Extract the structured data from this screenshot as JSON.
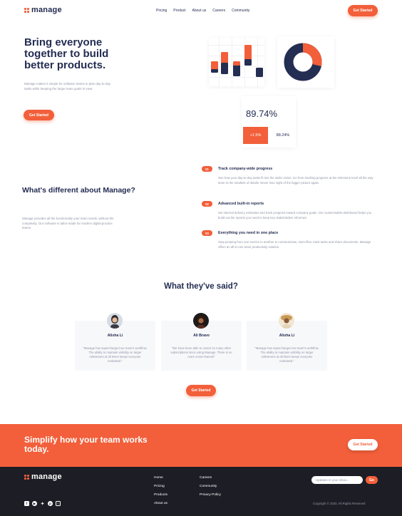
{
  "brand": {
    "name": "manage",
    "accent": "#f25f3a",
    "dark": "#242d52",
    "footer_bg": "#1d1e25"
  },
  "nav": {
    "items": [
      "Pricing",
      "Product",
      "About us",
      "Careers",
      "Community"
    ],
    "cta": "Get Started"
  },
  "hero": {
    "title": "Bring everyone together to build better products.",
    "description": "Manage makes it simple for software teams to plan day-to-day tasks while keeping the larger team goals in view.",
    "cta": "Get Started"
  },
  "illustration": {
    "stat_main": "89.74%",
    "stat_change": "+1.5%",
    "stat_secondary": "88.24%"
  },
  "features": {
    "title": "What's different about Manage?",
    "description": "Manage provides all the functionality your team needs, without the complexity. Our software is tailor-made for modern digital product teams.",
    "items": [
      {
        "num": "01",
        "title": "Track company-wide progress",
        "desc": "See how your day-to-day tasks fit into the wider vision. Go from tracking progress at the milestone level all the way done to the smallest of details. Never lose sight of the bigger picture again."
      },
      {
        "num": "02",
        "title": "Advanced built-in reports",
        "desc": "Set internal delivery estimates and track progress toward company goals. Our customisable dashboard helps you build out the reports you need to keep key stakeholders informed."
      },
      {
        "num": "03",
        "title": "Everything you need in one place",
        "desc": "Stop jumping from one service to another to communicate, store files, track tasks and share documents. Manage offers an all-in-one team productivity solution."
      }
    ]
  },
  "testimonials": {
    "title": "What they've said?",
    "items": [
      {
        "name": "Alisha Li",
        "quote": "\"Manage has supercharged our team's workflow. The ability to maintain visibility on larger milestones at all times keeps everyone motivated.\""
      },
      {
        "name": "Ali Bravo",
        "quote": "\"We have been able to cancel so many other subscriptions since using Manage. There is no more cross-channel\""
      },
      {
        "name": "Alisha Li",
        "quote": "\"Manage has supercharged our team's workflow. The ability to maintain visibility on larger milestones at all times keeps everyone motivated.\""
      }
    ],
    "cta": "Get Started"
  },
  "cta_band": {
    "title": "Simplify how your team works today.",
    "cta": "Get Started"
  },
  "footer": {
    "col1": [
      "Home",
      "Pricing",
      "Products",
      "About us"
    ],
    "col2": [
      "Careers",
      "Community",
      "Privacy Policy"
    ],
    "input_placeholder": "Updates in your inbox...",
    "go": "Go",
    "socials": [
      "facebook-icon",
      "youtube-icon",
      "twitter-icon",
      "pinterest-icon",
      "instagram-icon"
    ],
    "copyright": "Copyright © 2020, All Rights Reserved"
  }
}
